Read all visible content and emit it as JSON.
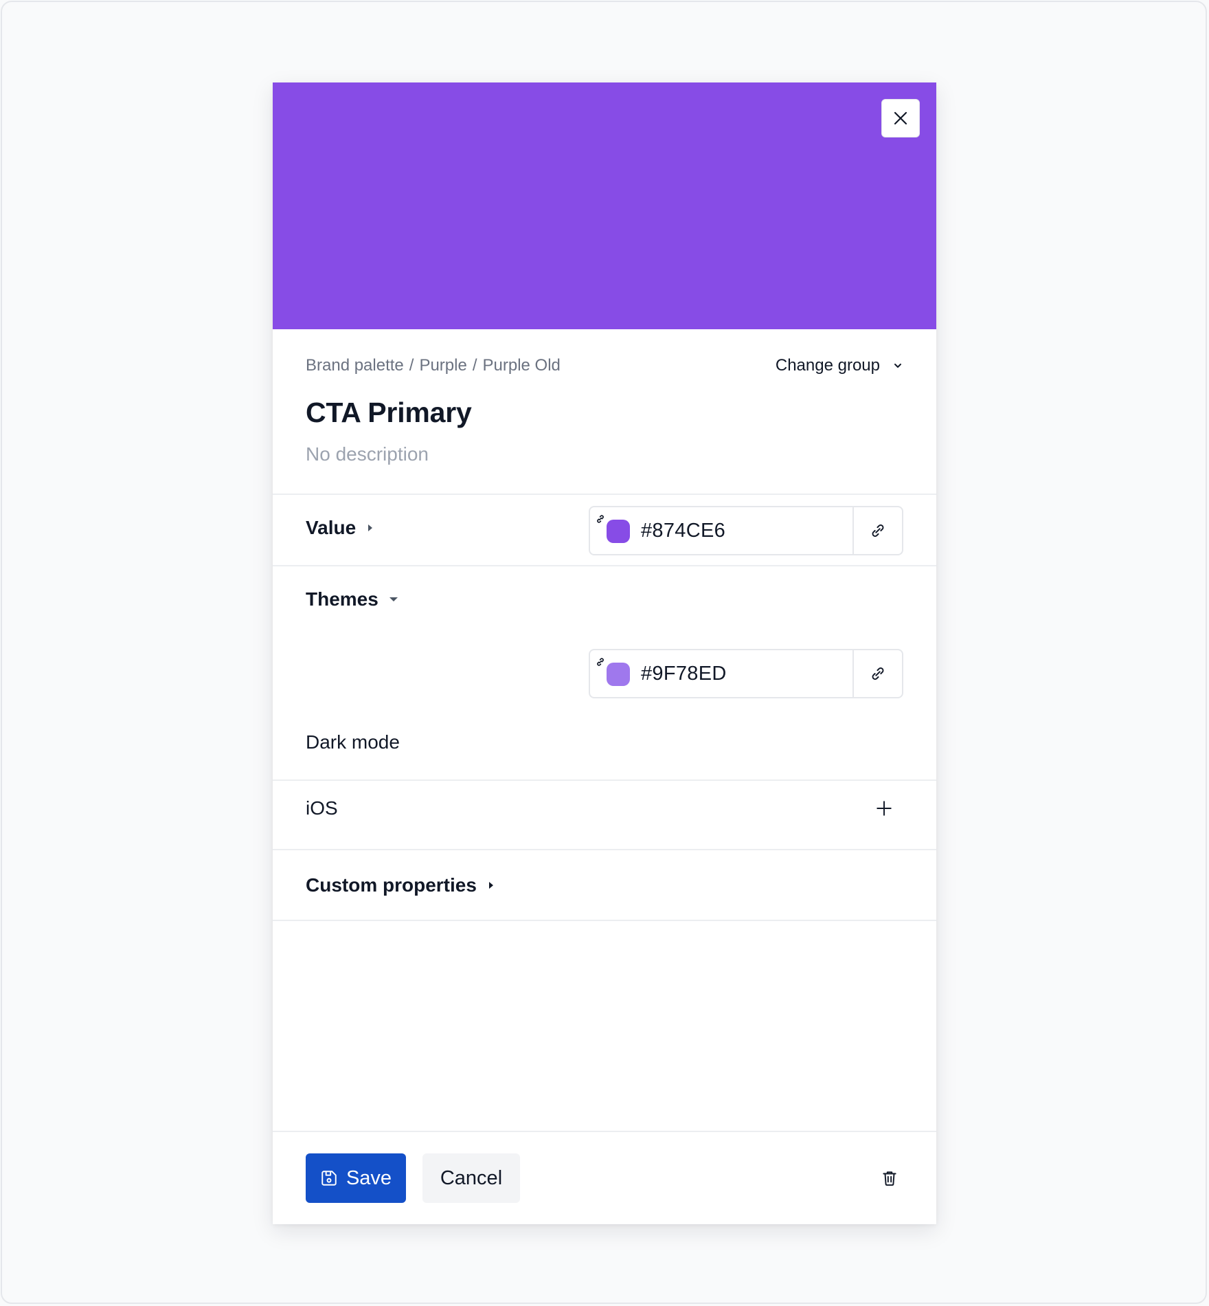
{
  "token": {
    "preview_color": "#874CE6",
    "breadcrumb": [
      "Brand palette",
      "Purple",
      "Purple Old"
    ],
    "breadcrumb_separator": "/",
    "change_group_label": "Change group",
    "title": "CTA Primary",
    "description": "No description"
  },
  "value_section": {
    "label": "Value",
    "color": "#874CE6",
    "hex": "#874CE6"
  },
  "themes_section": {
    "label": "Themes",
    "items": [
      {
        "label": "Dark mode",
        "color": "#9F78ED",
        "hex": "#9F78ED"
      },
      {
        "label": "iOS"
      }
    ]
  },
  "custom_properties": {
    "label": "Custom properties"
  },
  "footer": {
    "save_label": "Save",
    "cancel_label": "Cancel"
  },
  "icons": {
    "close": "close-icon",
    "chevron": "chevron-down-icon",
    "link": "link-icon",
    "plus": "plus-icon",
    "save": "save-icon",
    "delete": "trash-icon"
  }
}
